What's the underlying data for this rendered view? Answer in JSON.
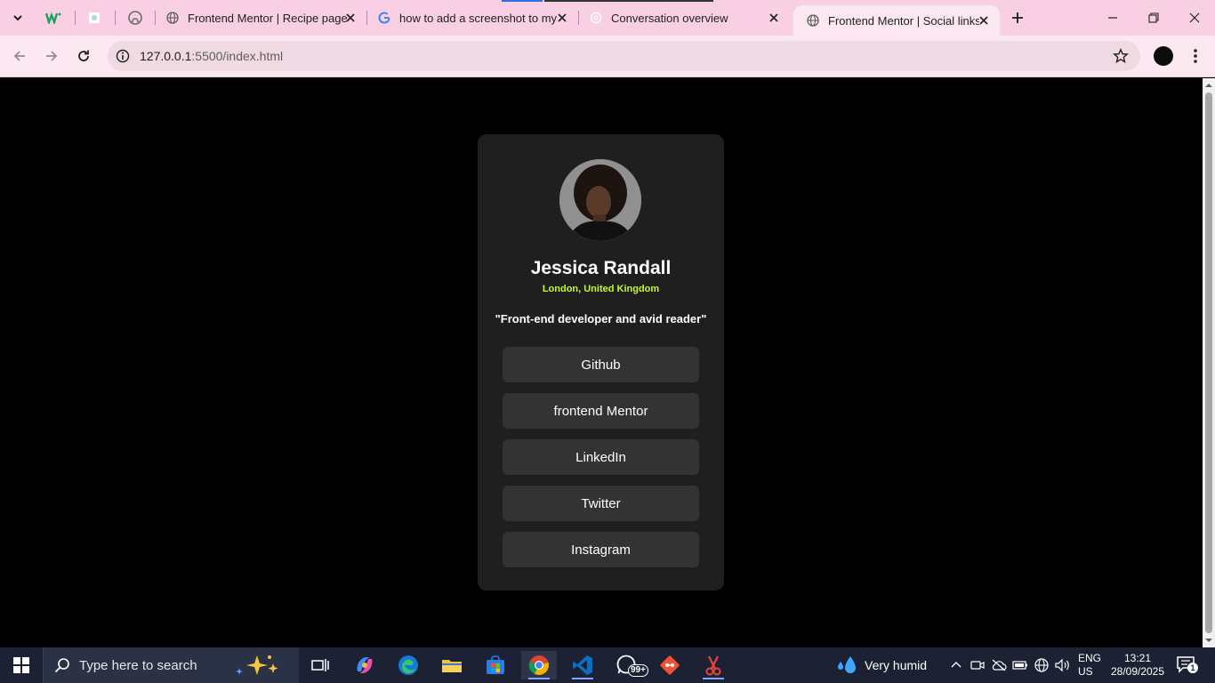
{
  "browser": {
    "tabs": [
      {
        "title": "Frontend Mentor | Recipe page",
        "favicon": "globe-icon"
      },
      {
        "title": "how to add a screenshot to my",
        "favicon": "google-icon"
      },
      {
        "title": "Conversation overview",
        "favicon": "chatgpt-icon"
      },
      {
        "title": "Frontend Mentor | Social links p",
        "favicon": "globe-icon",
        "active": true
      }
    ],
    "address": {
      "host": "127.0.0.1",
      "rest": ":5500/index.html"
    }
  },
  "profile_card": {
    "name": "Jessica Randall",
    "location": "London, United Kingdom",
    "bio": "\"Front-end developer and avid reader\"",
    "links": [
      "Github",
      "frontend Mentor",
      "LinkedIn",
      "Twitter",
      "Instagram"
    ]
  },
  "taskbar": {
    "search_placeholder": "Type here to search",
    "whatsapp_badge": "99+",
    "weather": "Very humid",
    "language": [
      "ENG",
      "US"
    ],
    "time": "13:21",
    "date": "28/09/2025",
    "notifications": "1"
  },
  "colors": {
    "accent": "#c4f82a",
    "card": "#1f1f1f",
    "button": "#333333",
    "tabstrip": "#f9cfe3"
  }
}
